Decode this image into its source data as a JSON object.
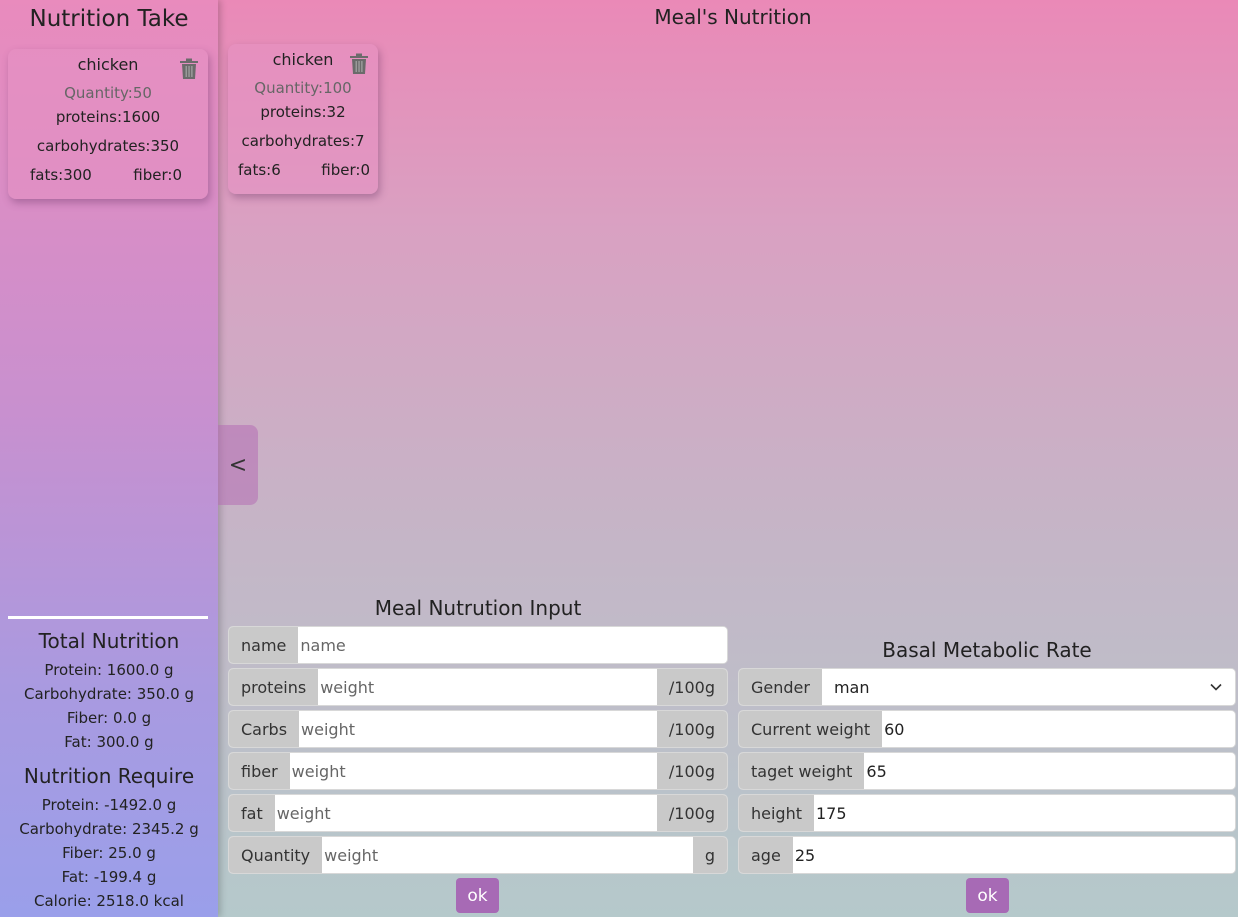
{
  "sidebar": {
    "title": "Nutrition Take",
    "card": {
      "name": "chicken",
      "quantity": "Quantity:50",
      "proteins": "proteins:1600",
      "carbohydrates": "carbohydrates:350",
      "fats": "fats:300",
      "fiber": "fiber:0"
    },
    "total": {
      "title": "Total Nutrition",
      "protein": "Protein: 1600.0 g",
      "carbohydrate": "Carbohydrate: 350.0 g",
      "fiber": "Fiber: 0.0 g",
      "fat": "Fat: 300.0 g"
    },
    "require": {
      "title": "Nutrition Require",
      "protein": "Protein: -1492.0 g",
      "carbohydrate": "Carbohydrate: 2345.2 g",
      "fiber": "Fiber: 25.0 g",
      "fat": "Fat: -199.4 g",
      "calorie": "Calorie: 2518.0 kcal"
    }
  },
  "toggle_label": "<",
  "main": {
    "title": "Meal's Nutrition",
    "card": {
      "name": "chicken",
      "quantity": "Quantity:100",
      "proteins": "proteins:32",
      "carbohydrates": "carbohydrates:7",
      "fats": "fats:6",
      "fiber": "fiber:0"
    }
  },
  "meal_input": {
    "title": "Meal Nutrution Input",
    "name_label": "name",
    "name_placeholder": "name",
    "proteins_label": "proteins",
    "carbs_label": "Carbs",
    "fiber_label": "fiber",
    "fat_label": "fat",
    "quantity_label": "Quantity",
    "weight_placeholder": "weight",
    "per_unit": "/100g",
    "quantity_unit": "g",
    "ok_label": "ok"
  },
  "bmr": {
    "title": "Basal Metabolic Rate",
    "gender_label": "Gender",
    "gender_value": "man",
    "current_weight_label": "Current weight",
    "current_weight_value": "60",
    "target_weight_label": "taget weight",
    "target_weight_value": "65",
    "height_label": "height",
    "height_value": "175",
    "age_label": "age",
    "age_value": "25",
    "ok_label": "ok"
  },
  "colors": {
    "accent": "#a76ab5",
    "trash_icon": "#6b6b6b"
  }
}
